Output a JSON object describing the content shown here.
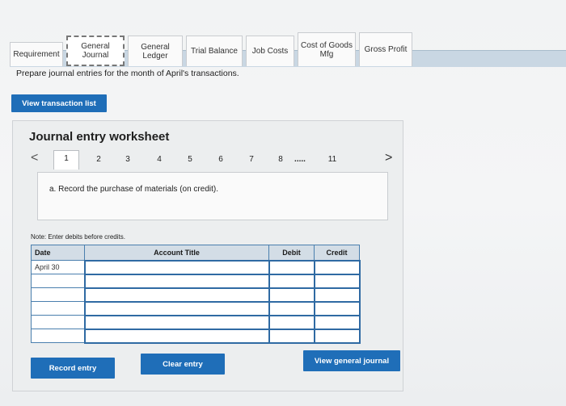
{
  "tabs": [
    {
      "label": "Requirement",
      "active": false
    },
    {
      "label": "General Journal",
      "active": true
    },
    {
      "label": "General Ledger",
      "active": false
    },
    {
      "label": "Trial Balance",
      "active": false
    },
    {
      "label": "Job Costs",
      "active": false
    },
    {
      "label": "Cost of Goods Mfg",
      "active": false
    },
    {
      "label": "Gross Profit",
      "active": false
    }
  ],
  "instruction": "Prepare journal entries for the month of April's transactions.",
  "view_transaction_list_label": "View transaction list",
  "worksheet": {
    "title": "Journal entry worksheet",
    "pager": {
      "prev_icon": "<",
      "next_icon": ">",
      "pages": [
        "1",
        "2",
        "3",
        "4",
        "5",
        "6",
        "7",
        "8"
      ],
      "ellipsis": ".....",
      "last": "11",
      "current": "1"
    },
    "question": "a. Record the purchase of materials (on credit).",
    "note": "Note: Enter debits before credits.",
    "table": {
      "headers": {
        "date": "Date",
        "account": "Account Title",
        "debit": "Debit",
        "credit": "Credit"
      },
      "rows": [
        {
          "date": "April 30",
          "account": "",
          "debit": "",
          "credit": ""
        },
        {
          "date": "",
          "account": "",
          "debit": "",
          "credit": ""
        },
        {
          "date": "",
          "account": "",
          "debit": "",
          "credit": ""
        },
        {
          "date": "",
          "account": "",
          "debit": "",
          "credit": ""
        },
        {
          "date": "",
          "account": "",
          "debit": "",
          "credit": ""
        },
        {
          "date": "",
          "account": "",
          "debit": "",
          "credit": ""
        }
      ]
    },
    "buttons": {
      "record": "Record entry",
      "clear": "Clear entry",
      "view_journal": "View general journal"
    }
  },
  "colors": {
    "primary_button": "#1f6eb8",
    "table_border": "#2f6aa3",
    "header_bg": "#d3dde6"
  }
}
